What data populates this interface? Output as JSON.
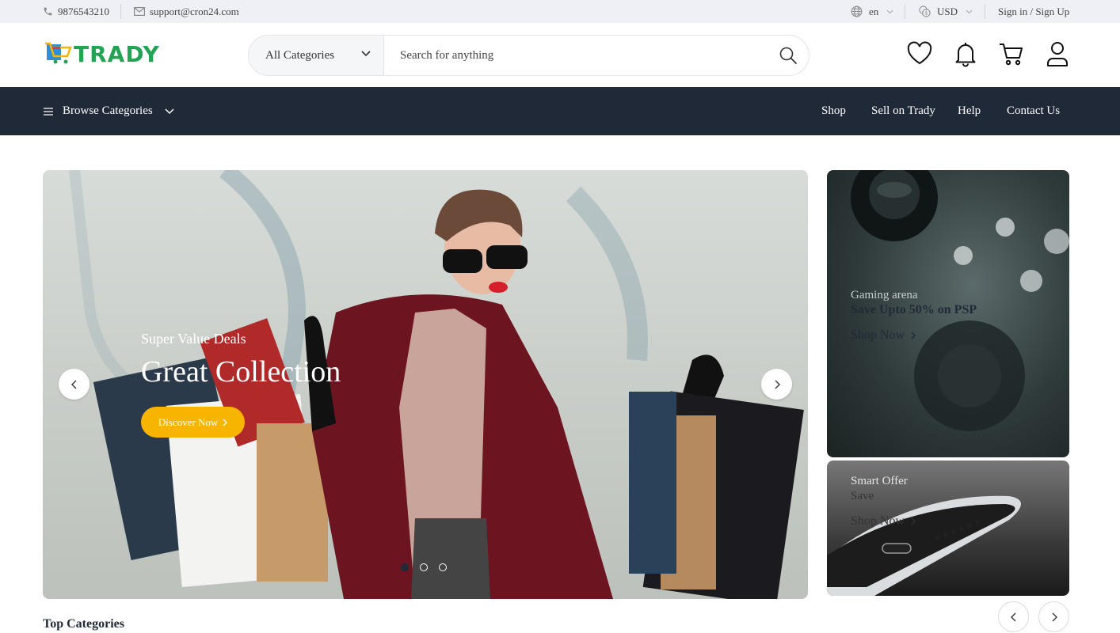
{
  "topbar": {
    "phone": "9876543210",
    "email": "support@cron24.com",
    "language": "en",
    "currency": "USD",
    "auth": "Sign in / Sign Up"
  },
  "header": {
    "logo": "TRADY",
    "category_select": "All Categories",
    "search_placeholder": "Search for anything"
  },
  "nav": {
    "browse": "Browse Categories",
    "links": [
      "Shop",
      "Sell on Trady",
      "Help",
      "Contact Us"
    ]
  },
  "hero": {
    "subtitle": "Super Value Deals",
    "title": "Great Collection",
    "button": "Discover Now",
    "slides": 3,
    "active_slide": 1
  },
  "side_banners": [
    {
      "subtitle": "Gaming arena",
      "title": "Save Upto 50% on PSP",
      "link": "Shop Now"
    },
    {
      "subtitle": "Smart Offer",
      "title": "Save",
      "link": "Shop Now"
    }
  ],
  "sections": {
    "top_categories": "Top Categories"
  },
  "colors": {
    "accent": "#f7b500",
    "nav_bg": "#1f2937",
    "brand": "#23a455"
  }
}
